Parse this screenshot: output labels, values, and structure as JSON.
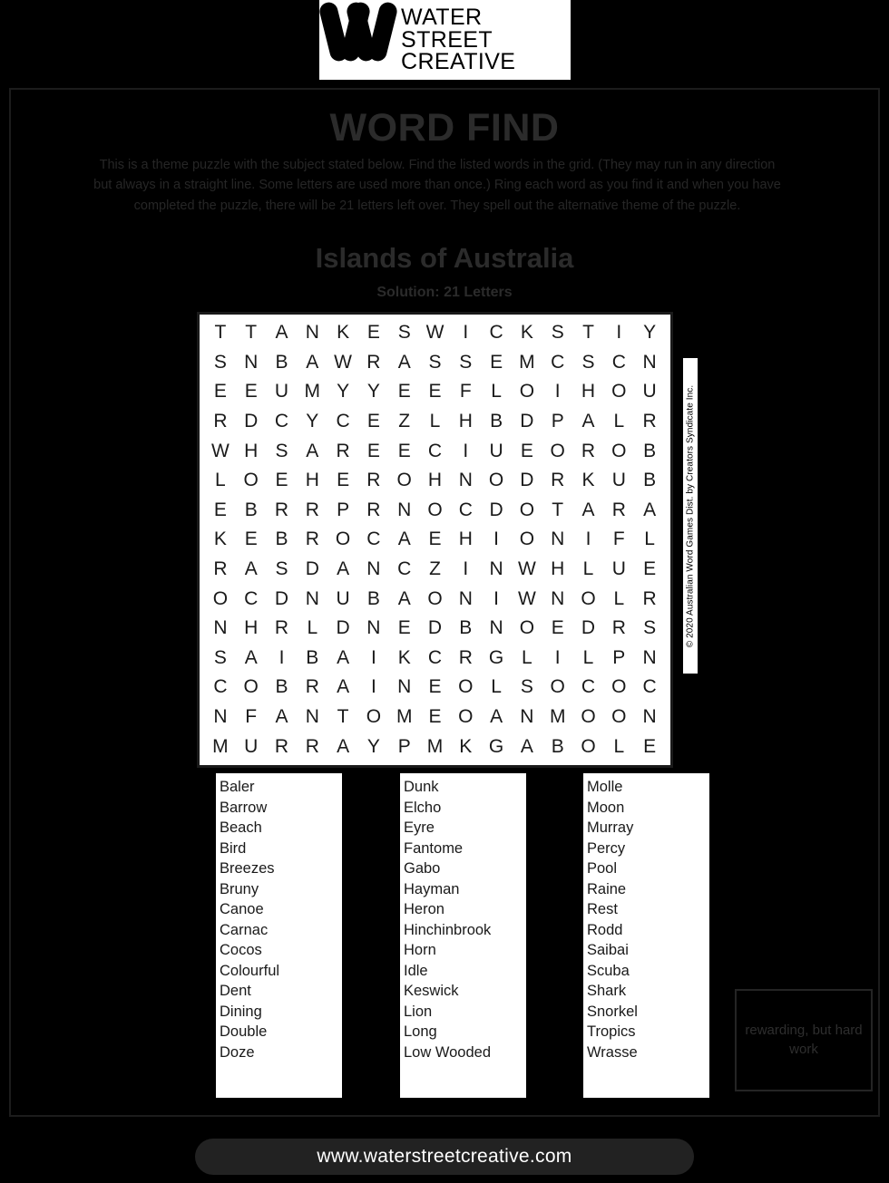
{
  "logo": {
    "mark": "w-monogram-icon",
    "line1": "WATER",
    "line2": "STREET",
    "line3": "CREATIVE"
  },
  "header": {
    "title": "WORD FIND",
    "instructions": "This is a theme puzzle with the subject stated below. Find the listed words in the grid. (They may run in any direction but always in a straight line. Some letters are used more than once.) Ring each word as you find it and when you have completed the puzzle, there will be 21 letters left over. They spell out the alternative theme of the puzzle.",
    "theme": "Islands of Australia",
    "solution_label": "Solution: 21 Letters"
  },
  "grid": {
    "rows": 15,
    "cols": 15,
    "letters": [
      [
        "T",
        "T",
        "A",
        "N",
        "K",
        "E",
        "S",
        "W",
        "I",
        "C",
        "K",
        "S",
        "T",
        "I",
        "Y"
      ],
      [
        "S",
        "N",
        "B",
        "A",
        "W",
        "R",
        "A",
        "S",
        "S",
        "E",
        "M",
        "C",
        "S",
        "C",
        "N"
      ],
      [
        "E",
        "E",
        "U",
        "M",
        "Y",
        "Y",
        "E",
        "E",
        "F",
        "L",
        "O",
        "I",
        "H",
        "O",
        "U"
      ],
      [
        "R",
        "D",
        "C",
        "Y",
        "C",
        "E",
        "Z",
        "L",
        "H",
        "B",
        "D",
        "P",
        "A",
        "L",
        "R"
      ],
      [
        "W",
        "H",
        "S",
        "A",
        "R",
        "E",
        "E",
        "C",
        "I",
        "U",
        "E",
        "O",
        "R",
        "O",
        "B"
      ],
      [
        "L",
        "O",
        "E",
        "H",
        "E",
        "R",
        "O",
        "H",
        "N",
        "O",
        "D",
        "R",
        "K",
        "U",
        "B"
      ],
      [
        "E",
        "B",
        "R",
        "R",
        "P",
        "R",
        "N",
        "O",
        "C",
        "D",
        "O",
        "T",
        "A",
        "R",
        "A"
      ],
      [
        "K",
        "E",
        "B",
        "R",
        "O",
        "C",
        "A",
        "E",
        "H",
        "I",
        "O",
        "N",
        "I",
        "F",
        "L"
      ],
      [
        "R",
        "A",
        "S",
        "D",
        "A",
        "N",
        "C",
        "Z",
        "I",
        "N",
        "W",
        "H",
        "L",
        "U",
        "E"
      ],
      [
        "O",
        "C",
        "D",
        "N",
        "U",
        "B",
        "A",
        "O",
        "N",
        "I",
        "W",
        "N",
        "O",
        "L",
        "R"
      ],
      [
        "N",
        "H",
        "R",
        "L",
        "D",
        "N",
        "E",
        "D",
        "B",
        "N",
        "O",
        "E",
        "D",
        "R",
        "S"
      ],
      [
        "S",
        "A",
        "I",
        "B",
        "A",
        "I",
        "K",
        "C",
        "R",
        "G",
        "L",
        "I",
        "L",
        "P",
        "N"
      ],
      [
        "C",
        "O",
        "B",
        "R",
        "A",
        "I",
        "N",
        "E",
        "O",
        "L",
        "S",
        "O",
        "C",
        "O",
        "C"
      ],
      [
        "N",
        "F",
        "A",
        "N",
        "T",
        "O",
        "M",
        "E",
        "O",
        "A",
        "N",
        "M",
        "O",
        "O",
        "N"
      ],
      [
        "M",
        "U",
        "R",
        "R",
        "A",
        "Y",
        "P",
        "M",
        "K",
        "G",
        "A",
        "B",
        "O",
        "L",
        "E"
      ]
    ]
  },
  "copyright": "© 2020 Australian Word Games Dist. by Creators Syndicate Inc.",
  "word_lists": {
    "column1": [
      "Baler",
      "Barrow",
      "Beach",
      "Bird",
      "Breezes",
      "Bruny",
      "Canoe",
      "Carnac",
      "Cocos",
      "Colourful",
      "Dent",
      "Dining",
      "Double",
      "Doze"
    ],
    "column2": [
      "Dunk",
      "Elcho",
      "Eyre",
      "Fantome",
      "Gabo",
      "Hayman",
      "Heron",
      "Hinchinbrook",
      "Horn",
      "Idle",
      "Keswick",
      "Lion",
      "Long",
      "Low Wooded"
    ],
    "column3": [
      "Molle",
      "Moon",
      "Murray",
      "Percy",
      "Pool",
      "Raine",
      "Rest",
      "Rodd",
      "Saibai",
      "Scuba",
      "Shark",
      "Snorkel",
      "Tropics",
      "Wrasse"
    ]
  },
  "answer_box": {
    "text": "rewarding, but hard work"
  },
  "footer": {
    "url": "www.waterstreetcreative.com"
  },
  "colors": {
    "background": "#000000",
    "paper": "#ffffff",
    "muted_text": "#2b2b2b",
    "footer_pill": "#222222"
  }
}
